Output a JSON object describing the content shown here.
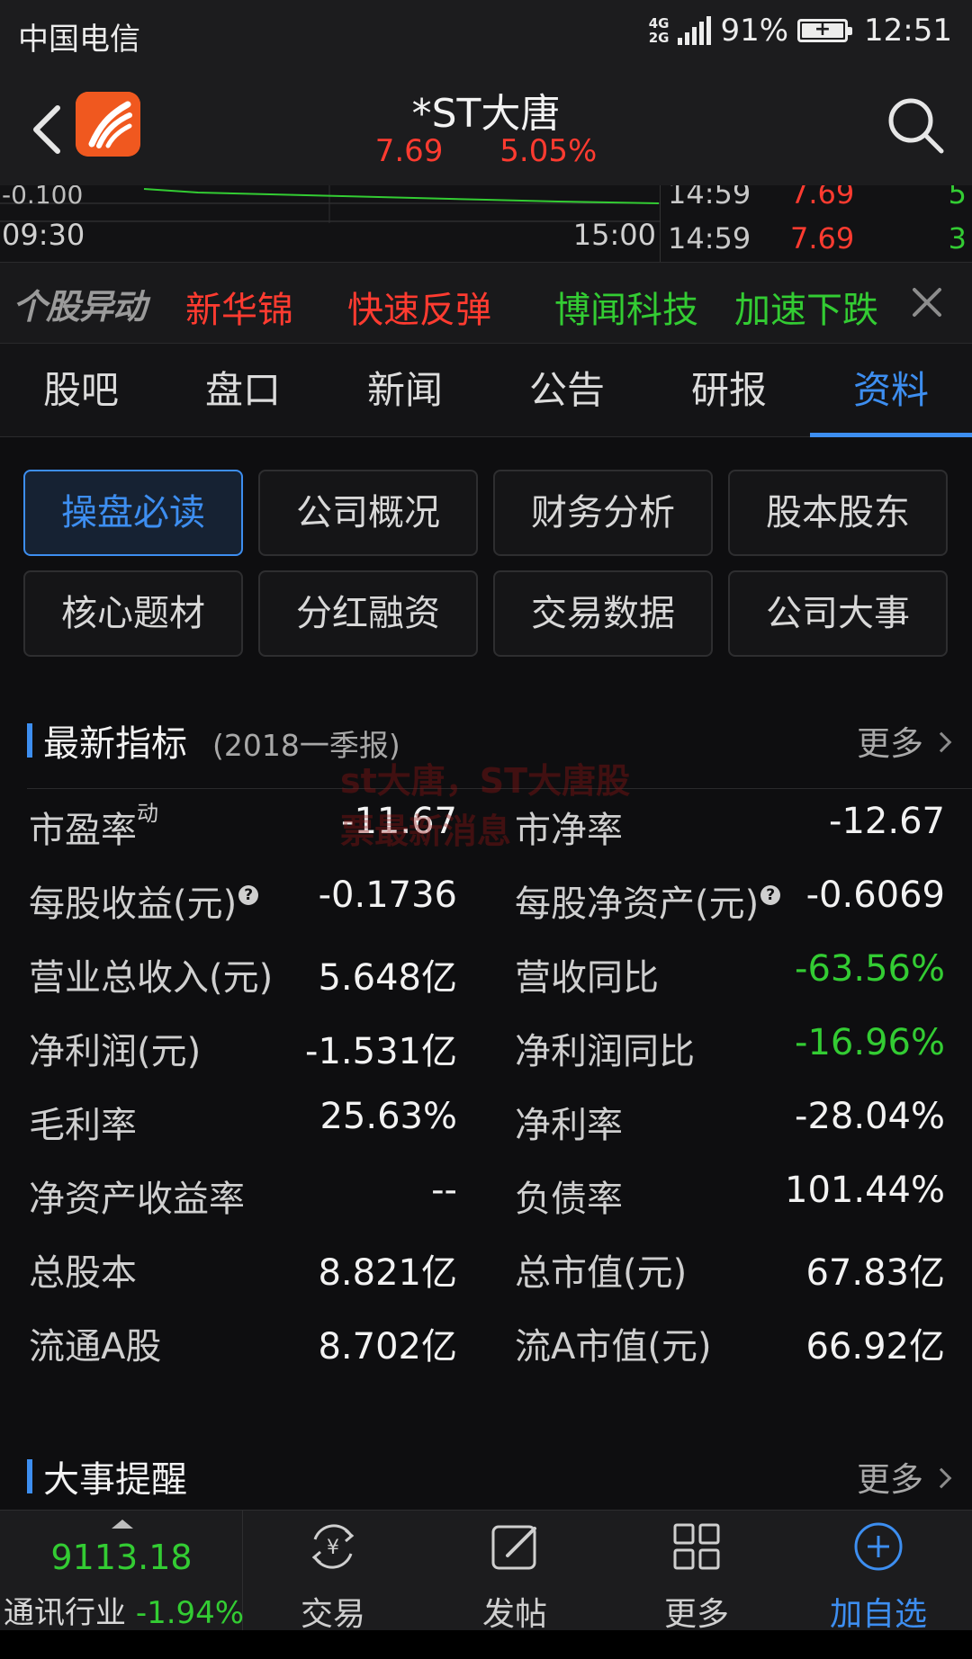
{
  "status": {
    "carrier": "中国电信",
    "network": "4G\n2G",
    "battery": "91%",
    "time": "12:51"
  },
  "header": {
    "title": "*ST大唐",
    "price": "7.69",
    "change_pct": "5.05%"
  },
  "mini_chart": {
    "y_label": "-0.100",
    "time_start": "09:30",
    "time_end": "15:00",
    "ticks": [
      {
        "time": "14:59",
        "price": "7.69",
        "volume": "5"
      },
      {
        "time": "14:59",
        "price": "7.69",
        "volume": "3"
      }
    ]
  },
  "ticker": {
    "logo": "个股异动",
    "items": [
      {
        "text": "新华锦",
        "color": "#ff3b30"
      },
      {
        "text": "快速反弹",
        "color": "#ff3b30"
      },
      {
        "text": "博闻科技",
        "color": "#33cc33"
      },
      {
        "text": "加速下跌",
        "color": "#33cc33"
      }
    ]
  },
  "tabs": [
    "股吧",
    "盘口",
    "新闻",
    "公告",
    "研报",
    "资料"
  ],
  "active_tab": 5,
  "sub_buttons": [
    "操盘必读",
    "公司概况",
    "财务分析",
    "股本股东",
    "核心题材",
    "分红融资",
    "交易数据",
    "公司大事"
  ],
  "section_latest": {
    "title": "最新指标",
    "subtitle": "(2018一季报)",
    "more": "更多"
  },
  "metrics": [
    {
      "l_label": "市盈率",
      "l_sup": "动",
      "l_value": "-11.67",
      "r_label": "市净率",
      "r_value": "-12.67"
    },
    {
      "l_label": "每股收益(元)",
      "l_q": "?",
      "l_value": "-0.1736",
      "r_label": "每股净资产(元)",
      "r_q": "?",
      "r_value": "-0.6069"
    },
    {
      "l_label": "营业总收入(元)",
      "l_value": "5.648亿",
      "r_label": "营收同比",
      "r_value": "-63.56%",
      "r_green": true
    },
    {
      "l_label": "净利润(元)",
      "l_value": "-1.531亿",
      "r_label": "净利润同比",
      "r_value": "-16.96%",
      "r_green": true
    },
    {
      "l_label": "毛利率",
      "l_value": "25.63%",
      "r_label": "净利率",
      "r_value": "-28.04%"
    },
    {
      "l_label": "净资产收益率",
      "l_value": "--",
      "r_label": "负债率",
      "r_value": "101.44%"
    },
    {
      "l_label": "总股本",
      "l_value": "8.821亿",
      "r_label": "总市值(元)",
      "r_value": "67.83亿"
    },
    {
      "l_label": "流通A股",
      "l_value": "8.702亿",
      "r_label": "流A市值(元)",
      "r_value": "66.92亿"
    }
  ],
  "watermark": {
    "line1": "st大唐，ST大唐股",
    "line2": "票最新消息"
  },
  "section_events": {
    "title": "大事提醒",
    "more": "更多"
  },
  "bottom": {
    "index_value": "9113.18",
    "index_name": "通讯行业",
    "index_change": "-1.94%",
    "nav": [
      "交易",
      "发帖",
      "更多",
      "加自选"
    ]
  },
  "colors": {
    "accent": "#3d8ef0",
    "up": "#ff3b30",
    "down": "#33cc33"
  }
}
